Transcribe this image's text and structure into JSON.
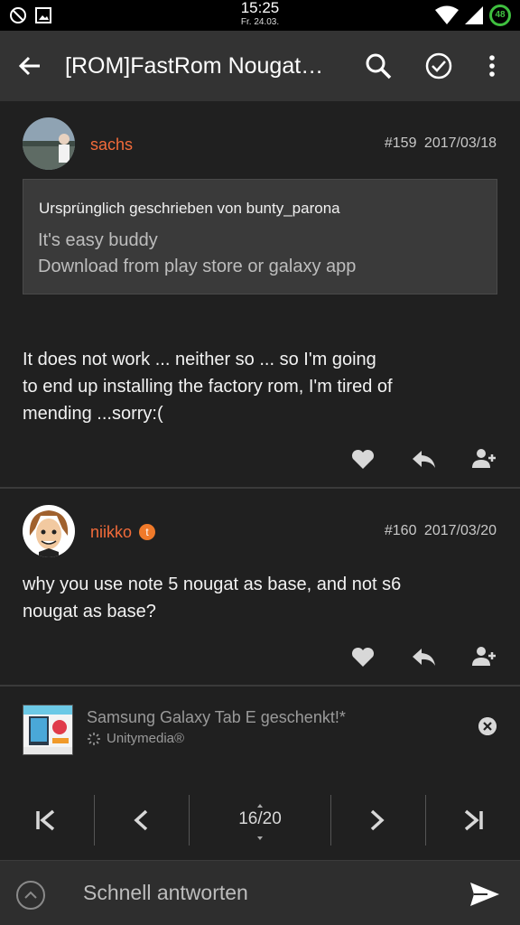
{
  "status_bar": {
    "time": "15:25",
    "date": "Fr. 24.03.",
    "battery": "48"
  },
  "toolbar": {
    "title": "[ROM]FastRom Nougat…"
  },
  "posts": [
    {
      "author": "sachs",
      "number": "#159",
      "date": "2017/03/18",
      "quote": {
        "header": "Ursprünglich geschrieben von bunty_parona",
        "lines": [
          "It's easy buddy",
          "Download from play store or galaxy app"
        ]
      },
      "lines": [
        "It does not work ... neither so ... so I'm going",
        "to end up installing the factory rom, I'm tired of",
        "mending ...sorry:("
      ]
    },
    {
      "author": "niikko",
      "number": "#160",
      "date": "2017/03/20",
      "lines": [
        "why you use note 5 nougat as base, and not s6",
        "nougat as base?"
      ]
    }
  ],
  "ad": {
    "title": "Samsung Galaxy Tab E geschenkt!*",
    "sponsor": "Unitymedia®"
  },
  "pager": {
    "current": "16",
    "total": "20"
  },
  "reply": {
    "placeholder": "Schnell antworten"
  },
  "colors": {
    "accent": "#f26b3a",
    "background": "#202020",
    "toolbar": "#333333"
  }
}
